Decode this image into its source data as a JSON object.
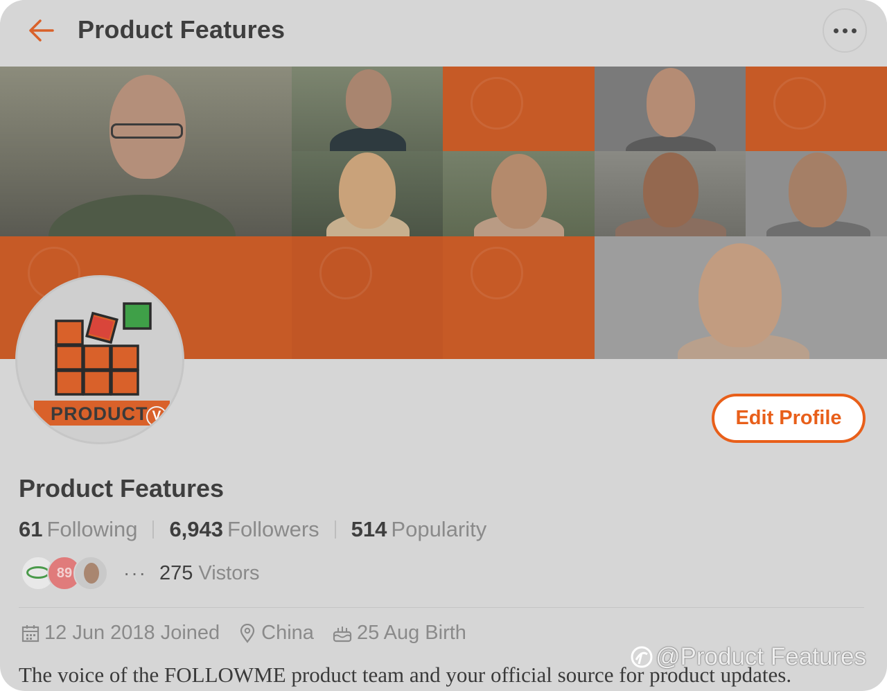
{
  "header": {
    "title": "Product Features",
    "back_icon": "arrow-left-icon",
    "more_icon": "more-horizontal-icon"
  },
  "profile": {
    "avatar_text": "PRODUCT",
    "avatar_badge": "V",
    "edit_label": "Edit Profile",
    "name": "Product Features",
    "stats": [
      {
        "value": "61",
        "label": "Following"
      },
      {
        "value": "6,943",
        "label": "Followers"
      },
      {
        "value": "514",
        "label": "Popularity"
      }
    ],
    "visitors": {
      "badge_number": "89",
      "dots": "···",
      "count": "275",
      "label": "Vistors"
    },
    "meta": [
      {
        "icon": "calendar-icon",
        "text": "12 Jun 2018 Joined"
      },
      {
        "icon": "location-pin-icon",
        "text": "China"
      },
      {
        "icon": "birthday-cake-icon",
        "text": "25 Aug Birth"
      }
    ],
    "bio": "The voice of the FOLLOWME product team and your official source for product updates."
  },
  "watermark": "@Product Features",
  "colors": {
    "accent": "#e85f1a",
    "banner_orange": "#c65a26",
    "background": "#d6d6d6",
    "text_dark": "#3e3e3e",
    "text_muted": "#8a8a8a"
  }
}
